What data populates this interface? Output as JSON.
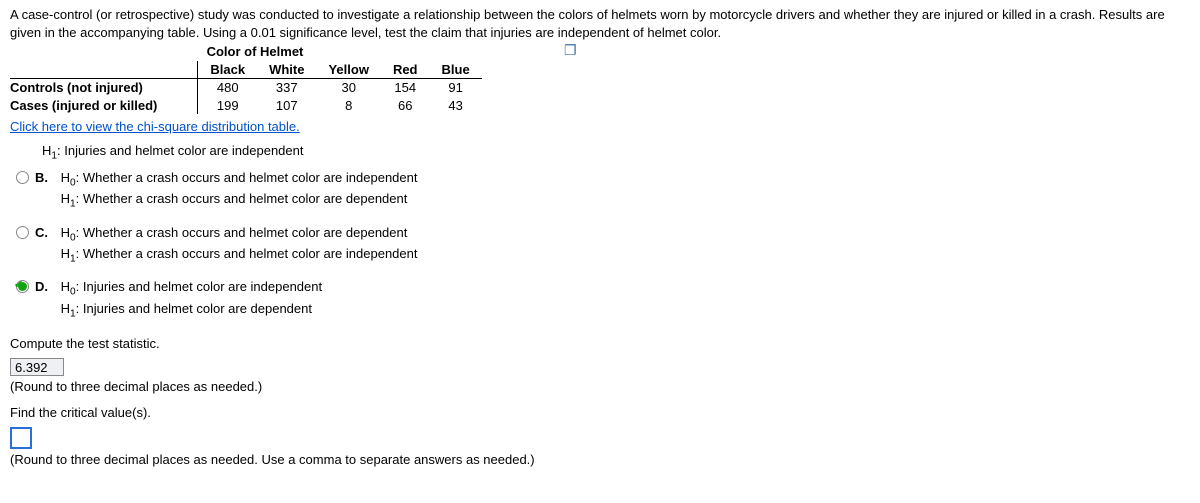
{
  "intro": "A case-control (or retrospective) study was conducted to investigate a relationship between the colors of helmets worn by motorcycle drivers and whether they are injured or killed in a crash. Results are given in the accompanying table. Using a 0.01 significance level, test the claim that injuries are independent of helmet color.",
  "table": {
    "caption": "Color of Helmet",
    "columns": [
      "Black",
      "White",
      "Yellow",
      "Red",
      "Blue"
    ],
    "rows": [
      {
        "label": "Controls (not injured)",
        "values": [
          "480",
          "337",
          "30",
          "154",
          "91"
        ]
      },
      {
        "label": "Cases (injured or killed)",
        "values": [
          "199",
          "107",
          "8",
          "66",
          "43"
        ]
      }
    ]
  },
  "link_text": "Click here to view the chi-square distribution table.",
  "options": {
    "a_partial": {
      "h1": "Injuries and helmet color are independent"
    },
    "b": {
      "letter": "B.",
      "h0": "Whether a crash occurs and helmet color are independent",
      "h1": "Whether a crash occurs and helmet color are dependent"
    },
    "c": {
      "letter": "C.",
      "h0": "Whether a crash occurs and helmet color are dependent",
      "h1": "Whether a crash occurs and helmet color are independent"
    },
    "d": {
      "letter": "D.",
      "h0": "Injuries and helmet color are independent",
      "h1": "Injuries and helmet color are dependent"
    }
  },
  "prompts": {
    "compute": "Compute the test statistic.",
    "stat_value": "6.392",
    "stat_hint": "(Round to three decimal places as needed.)",
    "critical": "Find the critical value(s).",
    "crit_value": "",
    "crit_hint": "(Round to three decimal places as needed. Use a comma to separate answers as needed.)"
  },
  "labels": {
    "h0": "H",
    "h0_sub": "0",
    "h1": "H",
    "h1_sub": "1",
    "sep": ": "
  }
}
